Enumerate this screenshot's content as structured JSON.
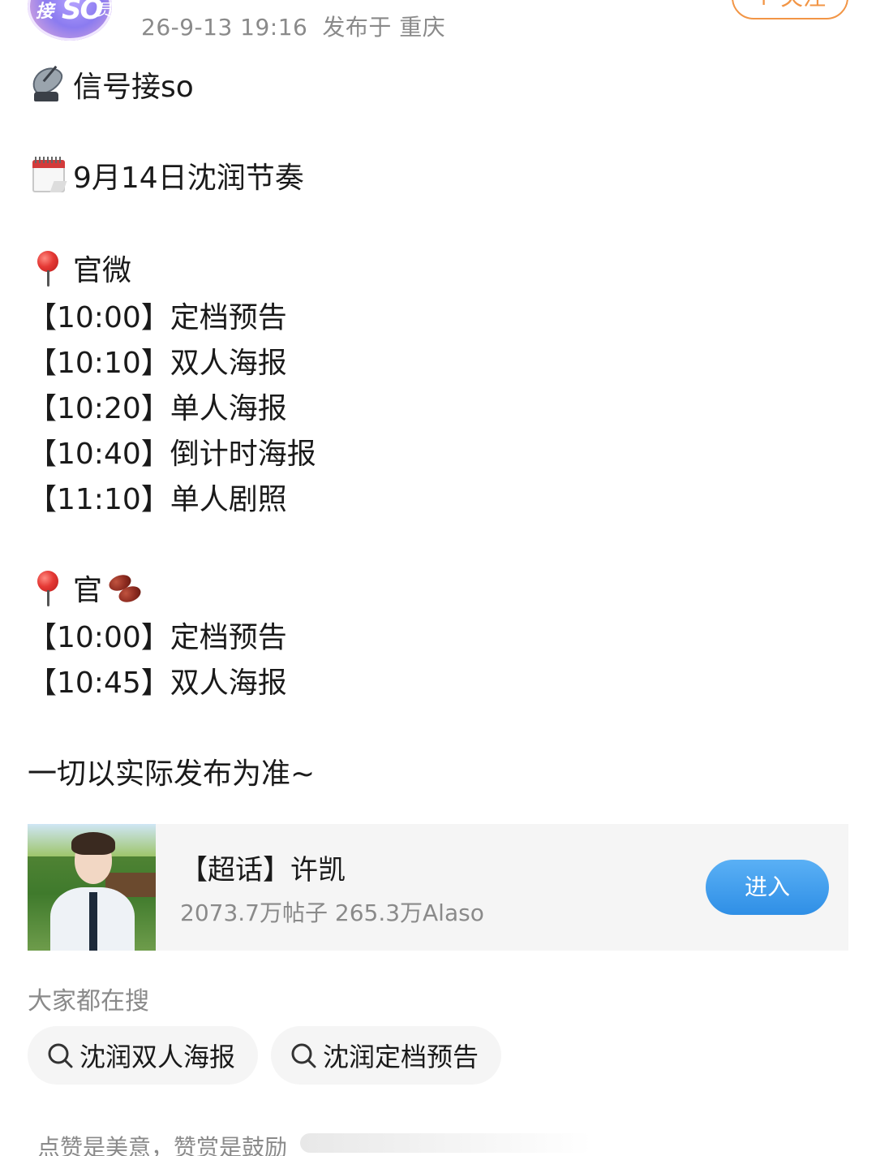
{
  "header": {
    "avatar_text_main": "接",
    "avatar_text_so": "SO",
    "avatar_text_side": "员",
    "timestamp": "26-9-13 19:16",
    "location": "发布于 重庆",
    "follow_label": "+ 关注"
  },
  "post": {
    "line_signal": "信号接so",
    "line_date": "9月14日沈润节奏",
    "section1_title": "官微",
    "section1_items": [
      "【10:00】定档预告",
      "【10:10】双人海报",
      "【10:20】单人海报",
      "【10:40】倒计时海报",
      "【11:10】单人剧照"
    ],
    "section2_title": "官",
    "section2_items": [
      "【10:00】定档预告",
      "【10:45】双人海报"
    ],
    "closing": "一切以实际发布为准~"
  },
  "topic_card": {
    "title": "【超话】许凯",
    "stats": "2073.7万帖子 265.3万Alaso",
    "enter_label": "进入"
  },
  "search": {
    "label": "大家都在搜",
    "chips": [
      "沈润双人海报",
      "沈润定档预告"
    ]
  },
  "footer": {
    "note": "点赞是美意，赞赏是鼓励"
  },
  "icons": {
    "signal": "satellite-dish-icon",
    "date": "calendar-icon",
    "pin": "pushpin-icon",
    "beans": "beans-icon",
    "search": "search-icon"
  },
  "colors": {
    "follow": "#f29545",
    "enter": "#2f8fe6",
    "muted": "#8a8a8a"
  }
}
